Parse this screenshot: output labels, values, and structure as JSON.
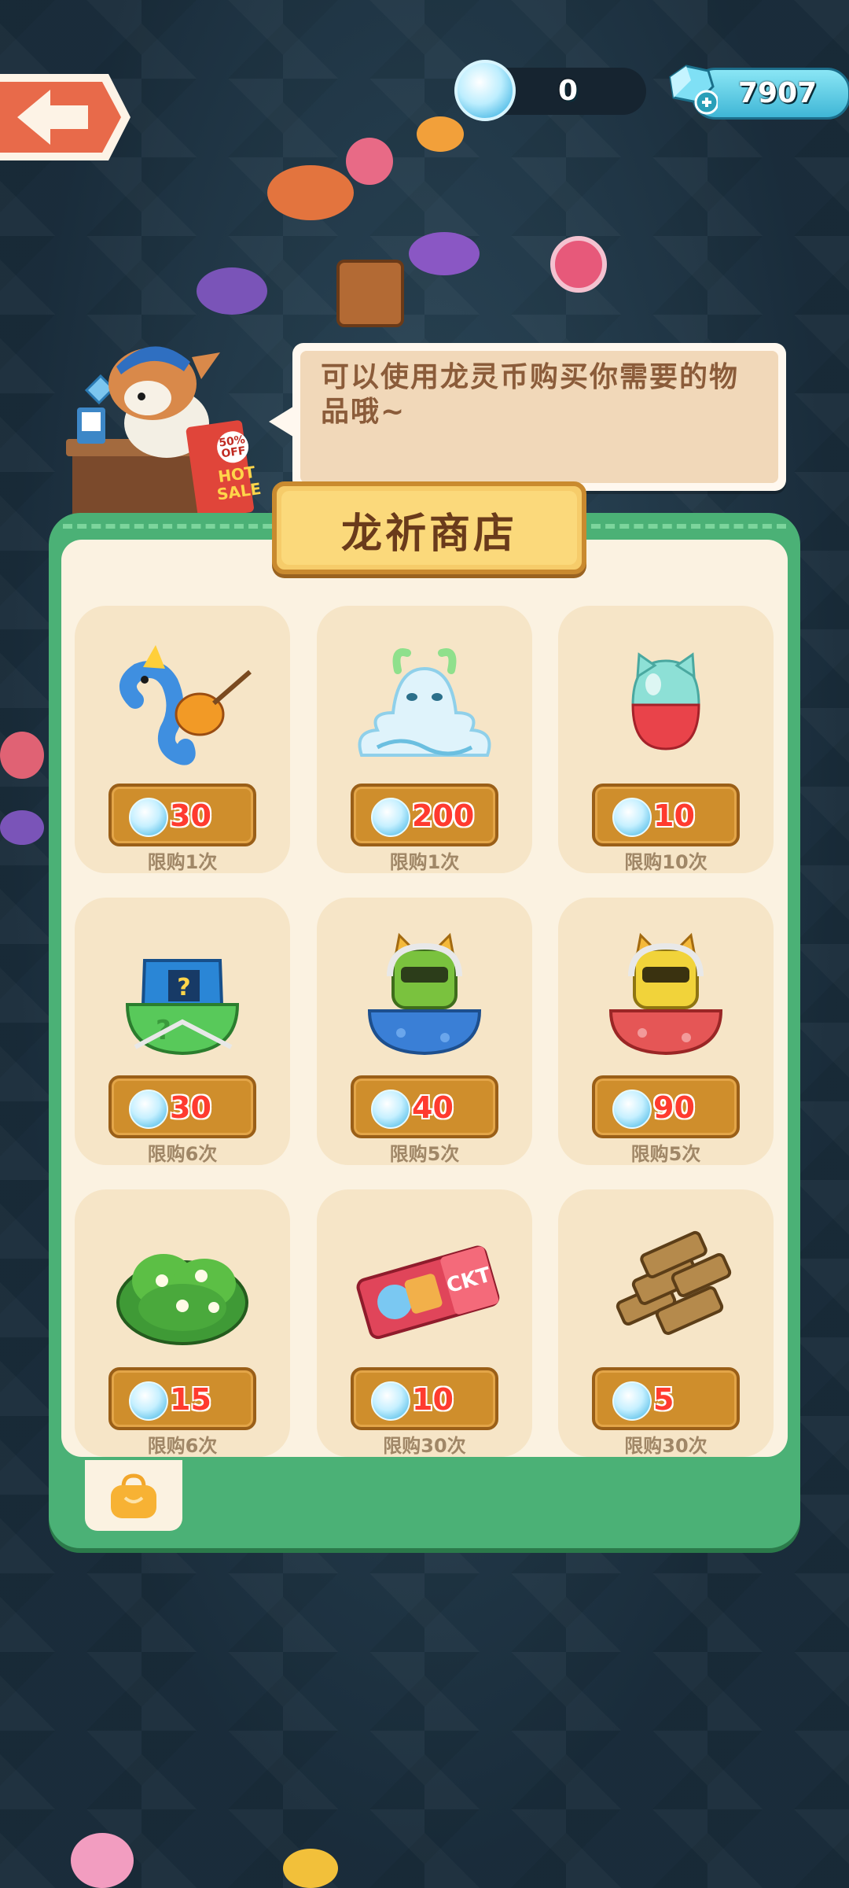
{
  "currency": {
    "coin_amount": "0",
    "gem_amount": "7907"
  },
  "npc": {
    "sign_top": "50%\nOFF",
    "sign_bottom": "HOT\nSALE",
    "speech": "可以使用龙灵币购买你需要的物品哦~"
  },
  "shop": {
    "title": "龙祈商店",
    "items": [
      {
        "icon": "seahorse-guitar",
        "price": "30",
        "limit": "限购1次"
      },
      {
        "icon": "water-dragon-spirit",
        "price": "200",
        "limit": "限购1次"
      },
      {
        "icon": "cat-capsule",
        "price": "10",
        "limit": "限购10次"
      },
      {
        "icon": "mystery-bag-green",
        "price": "30",
        "limit": "限购6次"
      },
      {
        "icon": "cat-bag-blue",
        "price": "40",
        "limit": "限购5次"
      },
      {
        "icon": "cat-bag-red",
        "price": "90",
        "limit": "限购5次"
      },
      {
        "icon": "green-bush",
        "price": "15",
        "limit": "限购6次"
      },
      {
        "icon": "ticket-pack",
        "price": "10",
        "limit": "限购30次"
      },
      {
        "icon": "wood-logs",
        "price": "5",
        "limit": "限购30次"
      }
    ]
  },
  "colors": {
    "panel_green": "#4bb176",
    "card_bg": "#f6e5c7",
    "price_text": "#ff3b2f",
    "price_button": "#cf8e2c"
  }
}
